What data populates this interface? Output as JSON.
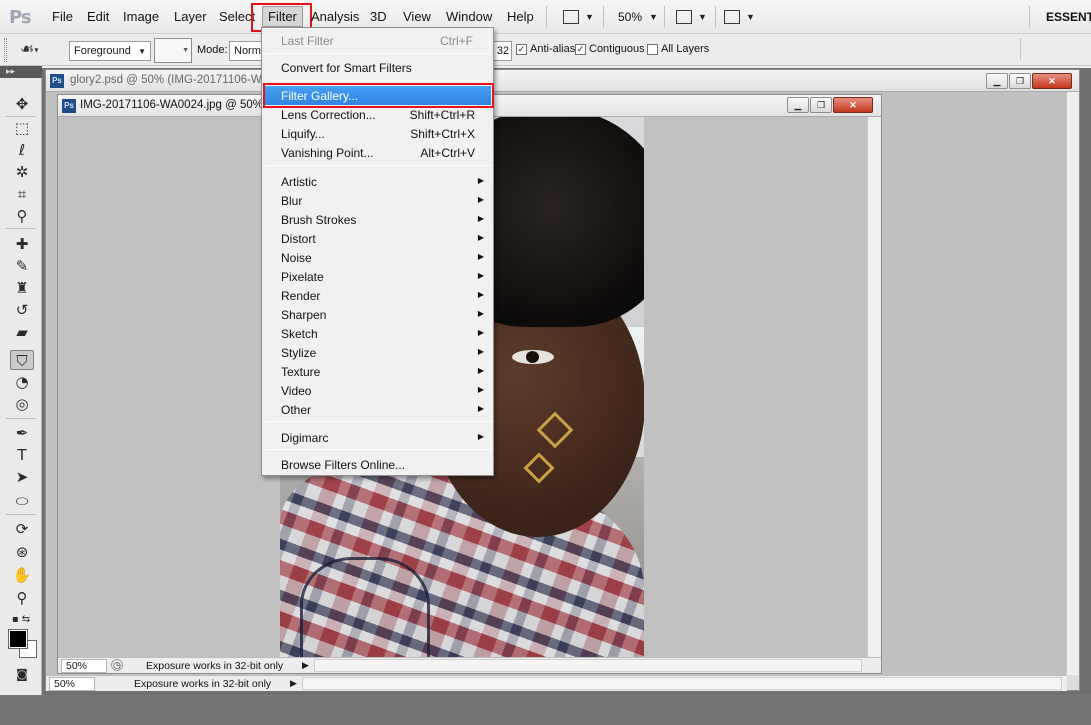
{
  "app": {
    "logo": "Ps",
    "workspace_label": "ESSENT"
  },
  "menubar": {
    "items": [
      "File",
      "Edit",
      "Image",
      "Layer",
      "Select",
      "Filter",
      "Analysis",
      "3D",
      "View",
      "Window",
      "Help"
    ],
    "zoom": "50%"
  },
  "options": {
    "fill_source": "Foreground",
    "mode_label": "Mode:",
    "mode_value": "Normal",
    "tolerance_value": "32",
    "antialias": "Anti-alias",
    "contiguous": "Contiguous",
    "all_layers": "All Layers"
  },
  "doc1": {
    "badge": "Ps",
    "title": "glory2.psd @ 50% (IMG-20171106-W...",
    "zoom": "50%",
    "status": "Exposure works in 32-bit only"
  },
  "doc2": {
    "badge": "Ps",
    "title": "IMG-20171106-WA0024.jpg @ 50%",
    "zoom": "50%",
    "status": "Exposure works in 32-bit only"
  },
  "filter_menu": {
    "last_filter": {
      "label": "Last Filter",
      "shortcut": "Ctrl+F"
    },
    "convert": "Convert for Smart Filters",
    "top_items": [
      {
        "label": "Filter Gallery...",
        "shortcut": ""
      },
      {
        "label": "Lens Correction...",
        "shortcut": "Shift+Ctrl+R"
      },
      {
        "label": "Liquify...",
        "shortcut": "Shift+Ctrl+X"
      },
      {
        "label": "Vanishing Point...",
        "shortcut": "Alt+Ctrl+V"
      }
    ],
    "submenus": [
      "Artistic",
      "Blur",
      "Brush Strokes",
      "Distort",
      "Noise",
      "Pixelate",
      "Render",
      "Sharpen",
      "Sketch",
      "Stylize",
      "Texture",
      "Video",
      "Other"
    ],
    "digimarc": "Digimarc",
    "browse": "Browse Filters Online..."
  },
  "icons": {
    "toolbox": [
      "move-icon",
      "marquee-icon",
      "lasso-icon",
      "quick-selection-icon",
      "crop-icon",
      "eyedropper-icon",
      "healing-brush-icon",
      "brush-icon",
      "clone-stamp-icon",
      "history-brush-icon",
      "eraser-icon",
      "paint-bucket-icon",
      "blur-icon",
      "dodge-icon",
      "pen-icon",
      "type-icon",
      "path-selection-icon",
      "ellipse-icon",
      "3d-rotate-icon",
      "3d-orbit-icon",
      "hand-icon",
      "zoom-icon"
    ]
  },
  "colors": {
    "highlight": "#3b93ea",
    "callout": "#e4121a",
    "foreground": "#000000",
    "background": "#ffffff"
  }
}
